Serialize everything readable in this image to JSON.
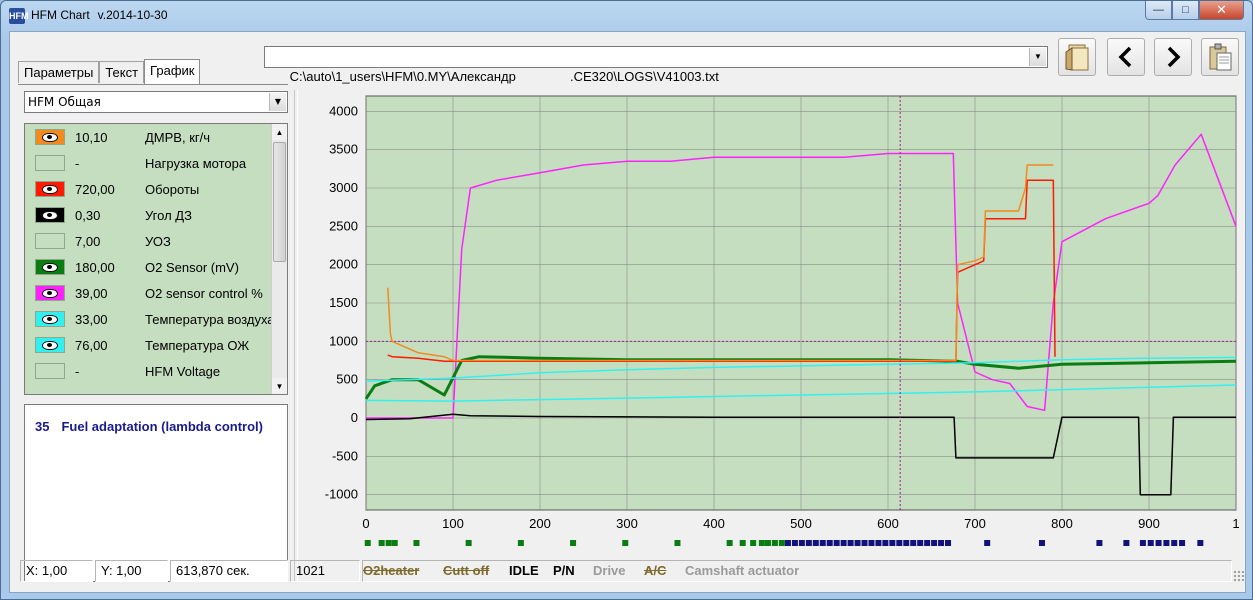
{
  "window": {
    "app_name": "HFM Chart",
    "version": "v.2014-10-30",
    "icon_label": "HFM"
  },
  "tabs": [
    {
      "label": "Параметры",
      "active": false
    },
    {
      "label": "Текст",
      "active": false
    },
    {
      "label": "График",
      "active": true
    }
  ],
  "preset": {
    "value": "HFM Общая"
  },
  "file_path": "C:\\auto\\1_users\\HFM\\0.MY\\Александр               .CE320\\LOGS\\V41003.txt",
  "channels": [
    {
      "color": "#f28a1e",
      "visible": true,
      "value": "10,10",
      "name": "ДМРВ, кг/ч"
    },
    {
      "color": "",
      "visible": false,
      "value": "-",
      "name": "Нагрузка мотора"
    },
    {
      "color": "#ff1a00",
      "visible": true,
      "value": "720,00",
      "name": "Обороты"
    },
    {
      "color": "#000000",
      "visible": true,
      "value": "0,30",
      "name": "Угол ДЗ"
    },
    {
      "color": "",
      "visible": false,
      "value": "7,00",
      "name": "УОЗ"
    },
    {
      "color": "#0a7d12",
      "visible": true,
      "value": "180,00",
      "name": "O2 Sensor (mV)"
    },
    {
      "color": "#ff22ff",
      "visible": true,
      "value": "39,00",
      "name": "O2 sensor control %"
    },
    {
      "color": "#33f0f0",
      "visible": true,
      "value": "33,00",
      "name": "Температура воздуха"
    },
    {
      "color": "#33f0f0",
      "visible": true,
      "value": "76,00",
      "name": "Температура ОЖ"
    },
    {
      "color": "",
      "visible": false,
      "value": "-",
      "name": "HFM Voltage"
    }
  ],
  "info": {
    "number": "35",
    "text": "Fuel adaptation (lambda control)"
  },
  "chart_data": {
    "type": "line",
    "xlim": [
      0,
      1000
    ],
    "ylim": [
      -1200,
      4200
    ],
    "x_ticks": [
      "0",
      "100",
      "200",
      "300",
      "400",
      "500",
      "600",
      "700",
      "800",
      "900",
      "1"
    ],
    "y_ticks": [
      "4000",
      "3500",
      "3000",
      "2500",
      "2000",
      "1500",
      "1000",
      "500",
      "0",
      "-500",
      "-1000"
    ],
    "cursor_x": 614,
    "reference_y": 1000,
    "background": "#c5dec0",
    "grid": true,
    "series": [
      {
        "color": "#ff22ff",
        "x": [
          0,
          100,
          110,
          120,
          150,
          200,
          250,
          300,
          350,
          400,
          450,
          500,
          550,
          600,
          650,
          675,
          680,
          700,
          720,
          740,
          760,
          780,
          790,
          800,
          850,
          900,
          910,
          930,
          960,
          970,
          1000
        ],
        "y": [
          0,
          0,
          2200,
          3000,
          3100,
          3200,
          3300,
          3350,
          3350,
          3400,
          3400,
          3400,
          3400,
          3450,
          3450,
          3450,
          1500,
          600,
          500,
          450,
          150,
          100,
          1500,
          2300,
          2600,
          2800,
          2900,
          3300,
          3700,
          3400,
          2500
        ]
      },
      {
        "color": "#0a7d12",
        "x": [
          0,
          10,
          30,
          60,
          90,
          110,
          130,
          200,
          300,
          400,
          500,
          600,
          680,
          700,
          750,
          800,
          900,
          1000
        ],
        "y": [
          250,
          420,
          500,
          500,
          300,
          750,
          800,
          780,
          760,
          760,
          760,
          760,
          740,
          700,
          650,
          700,
          720,
          740
        ]
      },
      {
        "color": "#33f0f0",
        "x": [
          0,
          100,
          200,
          300,
          400,
          500,
          600,
          700,
          800,
          900,
          1000
        ],
        "y": [
          480,
          520,
          590,
          630,
          660,
          680,
          700,
          720,
          760,
          780,
          790
        ]
      },
      {
        "color": "#33f0f0",
        "x": [
          0,
          100,
          200,
          300,
          400,
          500,
          600,
          700,
          800,
          900,
          1000
        ],
        "y": [
          230,
          220,
          240,
          260,
          280,
          300,
          320,
          340,
          370,
          400,
          430
        ]
      },
      {
        "color": "#ff1a00",
        "x": [
          25,
          30,
          60,
          90,
          100,
          678,
          680,
          700,
          710,
          712,
          750,
          758,
          760,
          790,
          792
        ],
        "y": [
          820,
          800,
          780,
          740,
          740,
          740,
          1900,
          2000,
          2050,
          2600,
          2600,
          2600,
          3100,
          3100,
          800
        ]
      },
      {
        "color": "#f28a1e",
        "x": [
          25,
          28,
          30,
          60,
          90,
          100,
          678,
          680,
          700,
          710,
          712,
          750,
          758,
          760,
          790
        ],
        "y": [
          1700,
          1100,
          1000,
          850,
          800,
          750,
          750,
          2000,
          2050,
          2100,
          2700,
          2700,
          3000,
          3300,
          3300
        ]
      },
      {
        "color": "#000000",
        "x": [
          0,
          50,
          100,
          120,
          200,
          400,
          600,
          676,
          678,
          680,
          760,
          790,
          800,
          888,
          890,
          925,
          928,
          1000
        ],
        "y": [
          -20,
          -10,
          50,
          30,
          20,
          10,
          10,
          10,
          -520,
          -520,
          -520,
          -520,
          10,
          10,
          -1000,
          -1000,
          10,
          10
        ]
      }
    ],
    "status_strips": [
      {
        "color": "#0a7d12",
        "x": [
          2,
          18,
          26,
          33,
          58,
          118,
          178,
          238,
          298,
          358,
          418,
          433,
          445,
          455,
          462,
          470,
          478
        ]
      },
      {
        "color": "#12127a",
        "x": [
          485,
          493,
          501,
          509,
          517,
          525,
          533,
          541,
          549,
          557,
          565,
          573,
          581,
          589,
          597,
          605,
          613,
          621,
          629,
          637,
          645,
          653,
          661,
          669,
          714,
          777,
          843,
          874,
          893,
          902,
          911,
          920,
          929,
          938,
          959
        ]
      }
    ]
  },
  "status": {
    "x": "X: 1,00",
    "y": "Y: 1,00",
    "time": "613,870 сек.",
    "count": "1021",
    "flags": [
      {
        "label": "O2heater",
        "state": "struck"
      },
      {
        "label": "Cutt off",
        "state": "struck"
      },
      {
        "label": "IDLE",
        "state": "on"
      },
      {
        "label": "P/N",
        "state": "on"
      },
      {
        "label": "Drive",
        "state": "off"
      },
      {
        "label": "A/C",
        "state": "struck"
      },
      {
        "label": "Camshaft actuator",
        "state": "off"
      }
    ]
  }
}
